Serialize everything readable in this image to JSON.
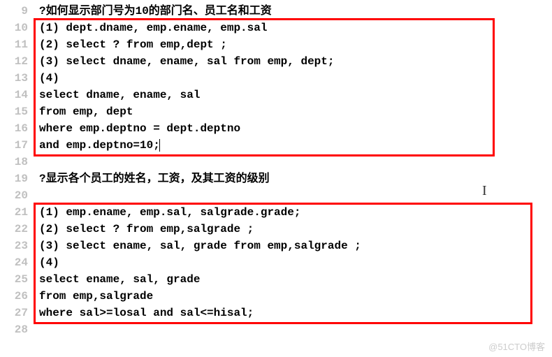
{
  "lines": [
    {
      "num": "9",
      "text": "?如何显示部门号为10的部门名、员工名和工资"
    },
    {
      "num": "10",
      "text": "(1) dept.dname, emp.ename, emp.sal"
    },
    {
      "num": "11",
      "text": "(2) select ? from emp,dept ;"
    },
    {
      "num": "12",
      "text": "(3) select dname, ename, sal from emp, dept;"
    },
    {
      "num": "13",
      "text": "(4)"
    },
    {
      "num": "14",
      "text": "select dname, ename, sal"
    },
    {
      "num": "15",
      "text": "from emp, dept"
    },
    {
      "num": "16",
      "text": "where emp.deptno = dept.deptno"
    },
    {
      "num": "17",
      "text": "and emp.deptno=10;"
    },
    {
      "num": "18",
      "text": ""
    },
    {
      "num": "19",
      "text": "?显示各个员工的姓名，工资，及其工资的级别"
    },
    {
      "num": "20",
      "text": ""
    },
    {
      "num": "21",
      "text": "(1) emp.ename, emp.sal, salgrade.grade;"
    },
    {
      "num": "22",
      "text": "(2) select ? from emp,salgrade ;"
    },
    {
      "num": "23",
      "text": "(3) select ename, sal, grade from emp,salgrade ;"
    },
    {
      "num": "24",
      "text": "(4)"
    },
    {
      "num": "25",
      "text": "select ename, sal, grade"
    },
    {
      "num": "26",
      "text": "from emp,salgrade"
    },
    {
      "num": "27",
      "text": "where sal>=losal and sal<=hisal;"
    },
    {
      "num": "28",
      "text": ""
    }
  ],
  "watermark": "@51CTO博客",
  "cursor_glyph": "I"
}
